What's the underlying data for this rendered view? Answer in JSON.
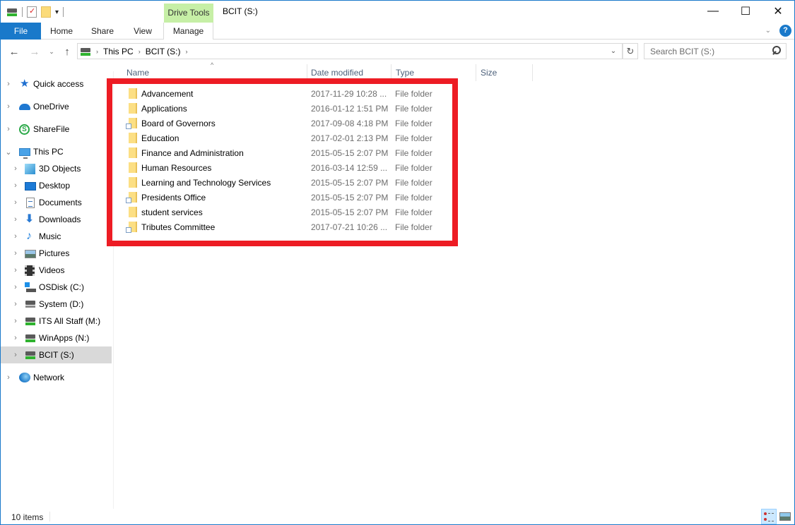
{
  "window": {
    "title": "BCIT (S:)",
    "context_tab": "Drive Tools",
    "controls": {
      "minimize": "—",
      "maximize": "☐",
      "close": "✕"
    }
  },
  "quick_access_toolbar": {
    "icons": [
      "network-drive-icon",
      "properties-icon",
      "new-folder-icon",
      "customize-dropdown-icon"
    ],
    "dropdown_glyph": "▾"
  },
  "ribbon": {
    "tabs": [
      {
        "label": "File",
        "active": true
      },
      {
        "label": "Home"
      },
      {
        "label": "Share"
      },
      {
        "label": "View"
      },
      {
        "label": "Manage"
      }
    ],
    "expand_glyph": "⌄",
    "help_glyph": "?"
  },
  "navigation": {
    "back_glyph": "←",
    "forward_glyph": "→",
    "recent_glyph": "⌄",
    "up_glyph": "↑",
    "breadcrumb": [
      "This PC",
      "BCIT (S:)"
    ],
    "crumb_separator": "›",
    "dropdown_glyph": "⌄",
    "refresh_glyph": "↻",
    "search_placeholder": "Search BCIT (S:)"
  },
  "sidebar": {
    "items": [
      {
        "label": "Quick access",
        "icon": "quick-access-star-icon",
        "chevron": "›"
      },
      {
        "label": "OneDrive",
        "icon": "onedrive-cloud-icon",
        "chevron": "›"
      },
      {
        "label": "ShareFile",
        "icon": "sharefile-icon",
        "chevron": "›"
      },
      {
        "label": "This PC",
        "icon": "this-pc-icon",
        "chevron": "⌄"
      },
      {
        "label": "3D Objects",
        "icon": "3d-objects-icon",
        "chevron": "›"
      },
      {
        "label": "Desktop",
        "icon": "desktop-icon",
        "chevron": "›"
      },
      {
        "label": "Documents",
        "icon": "documents-icon",
        "chevron": "›"
      },
      {
        "label": "Downloads",
        "icon": "downloads-icon",
        "chevron": "›"
      },
      {
        "label": "Music",
        "icon": "music-icon",
        "chevron": "›"
      },
      {
        "label": "Pictures",
        "icon": "pictures-icon",
        "chevron": "›"
      },
      {
        "label": "Videos",
        "icon": "videos-icon",
        "chevron": "›"
      },
      {
        "label": "OSDisk (C:)",
        "icon": "os-disk-icon",
        "chevron": "›"
      },
      {
        "label": "System (D:)",
        "icon": "local-drive-icon",
        "chevron": "›"
      },
      {
        "label": "ITS All Staff (M:)",
        "icon": "network-drive-icon",
        "chevron": "›"
      },
      {
        "label": "WinApps (N:)",
        "icon": "network-drive-icon",
        "chevron": "›"
      },
      {
        "label": "BCIT (S:)",
        "icon": "network-drive-icon",
        "chevron": "›",
        "selected": true
      },
      {
        "label": "Network",
        "icon": "network-icon",
        "chevron": "›"
      }
    ]
  },
  "file_list": {
    "columns": [
      "Name",
      "Date modified",
      "Type",
      "Size"
    ],
    "sort_glyph": "^",
    "rows": [
      {
        "name": "Advancement",
        "date": "2017-11-29 10:28 ...",
        "type": "File folder",
        "shortcut": false
      },
      {
        "name": "Applications",
        "date": "2016-01-12 1:51 PM",
        "type": "File folder",
        "shortcut": false
      },
      {
        "name": "Board of Governors",
        "date": "2017-09-08 4:18 PM",
        "type": "File folder",
        "shortcut": true
      },
      {
        "name": "Education",
        "date": "2017-02-01 2:13 PM",
        "type": "File folder",
        "shortcut": false
      },
      {
        "name": "Finance and Administration",
        "date": "2015-05-15 2:07 PM",
        "type": "File folder",
        "shortcut": false
      },
      {
        "name": "Human Resources",
        "date": "2016-03-14 12:59 ...",
        "type": "File folder",
        "shortcut": false
      },
      {
        "name": "Learning and Technology Services",
        "date": "2015-05-15 2:07 PM",
        "type": "File folder",
        "shortcut": false
      },
      {
        "name": "Presidents Office",
        "date": "2015-05-15 2:07 PM",
        "type": "File folder",
        "shortcut": true
      },
      {
        "name": "student services",
        "date": "2015-05-15 2:07 PM",
        "type": "File folder",
        "shortcut": false
      },
      {
        "name": "Tributes Committee",
        "date": "2017-07-21 10:26 ...",
        "type": "File folder",
        "shortcut": true
      }
    ]
  },
  "status_bar": {
    "item_count": "10 items",
    "views": [
      {
        "name": "details-view",
        "active": true
      },
      {
        "name": "large-icons-view",
        "active": false
      }
    ]
  },
  "colors": {
    "accent": "#1979ca",
    "context_tab": "#c6efa6",
    "highlight_box": "#ed1c24",
    "selected_nav": "#d9d9d9",
    "header_text": "#4c607a",
    "secondary_text": "#6d6d6d"
  }
}
